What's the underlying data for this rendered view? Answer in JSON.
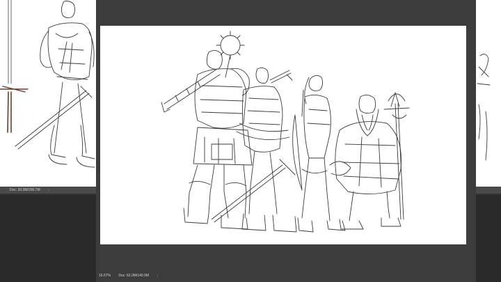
{
  "left_window": {
    "status": {
      "zoom": "",
      "doc_info": "Doc: 30.0M/200.7M",
      "arrow": "›"
    }
  },
  "main_window": {
    "status": {
      "zoom": "16.67%",
      "doc_info": "Doc: 62.0M/140.9M",
      "arrow": "›"
    }
  },
  "colors": {
    "workspace_bg": "#2a2a2a",
    "window_frame": "#3c3c3c",
    "status_bar": "#4a4a4a",
    "canvas": "#ffffff",
    "sketch_line": "#3a3a3a"
  }
}
